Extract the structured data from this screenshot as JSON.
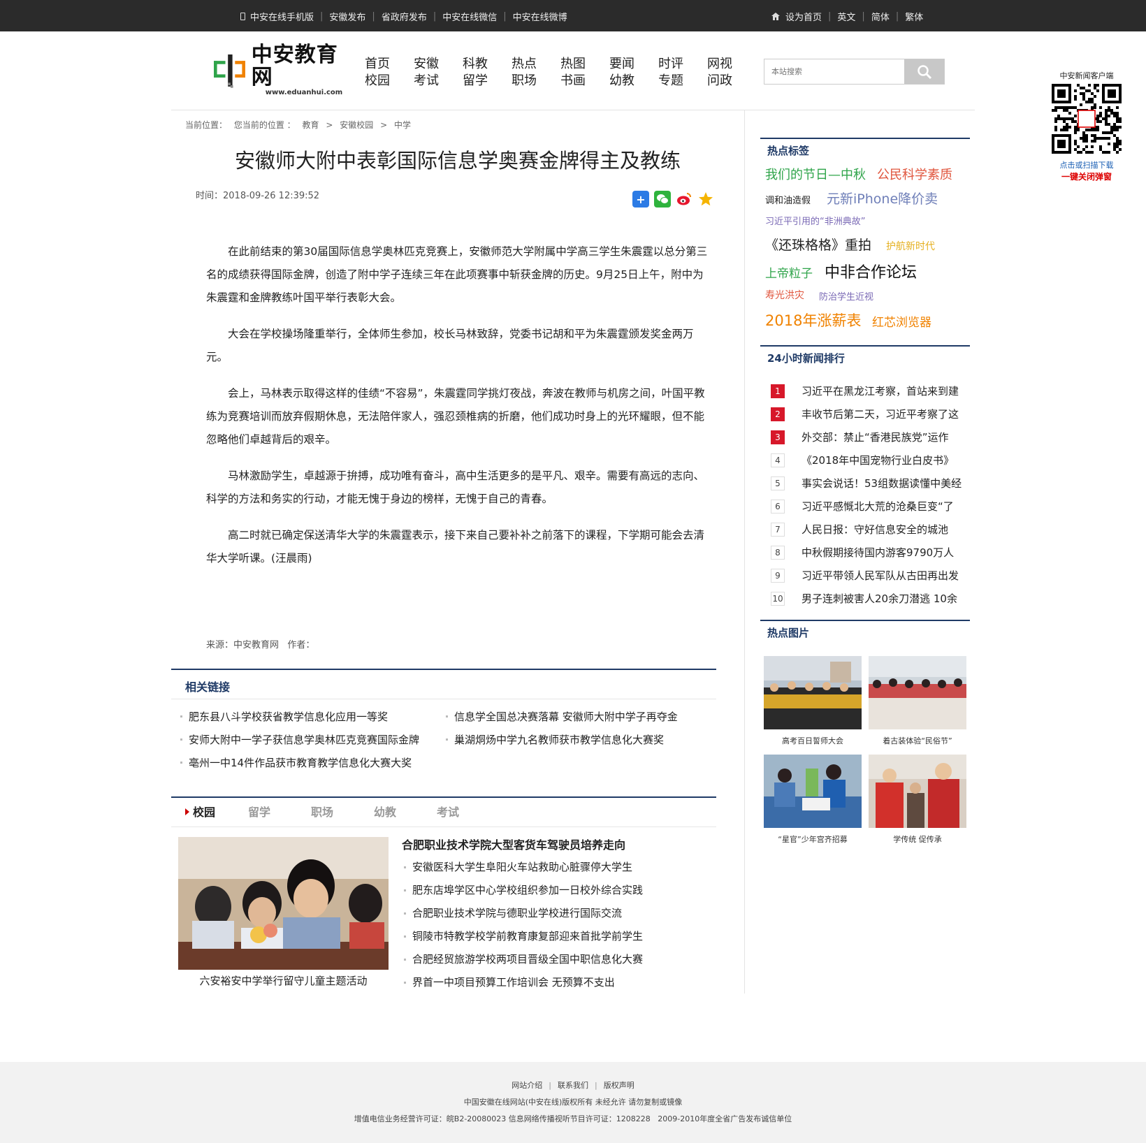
{
  "topbar": {
    "left_links": [
      "中安在线手机版",
      "安徽发布",
      "省政府发布",
      "中安在线微信",
      "中安在线微博"
    ],
    "right_links": [
      "设为首页",
      "英文",
      "简体",
      "繁体"
    ]
  },
  "logo": {
    "cn": "中安教育网",
    "en": "www.eduanhui.com"
  },
  "nav": [
    [
      "首页",
      "校园"
    ],
    [
      "安徽",
      "考试"
    ],
    [
      "科教",
      "留学"
    ],
    [
      "热点",
      "职场"
    ],
    [
      "热图",
      "书画"
    ],
    [
      "要闻",
      "幼教"
    ],
    [
      "时评",
      "专题"
    ],
    [
      "网视",
      "问政"
    ]
  ],
  "search": {
    "placeholder": "本站搜索"
  },
  "qr": {
    "title": "中安新闻客户端",
    "hint": "点击或扫描下载",
    "close": "一键关闭弹窗"
  },
  "breadcrumb": [
    "当前位置：",
    "您当前的位置 ：",
    "教育",
    ">",
    "安徽校园",
    ">",
    "中学"
  ],
  "article": {
    "title": "安徽师大附中表彰国际信息学奥赛金牌得主及教练",
    "time": "时间：2018-09-26 12:39:52",
    "paragraphs": [
      "在此前结束的第30届国际信息学奥林匹克竞赛上，安徽师范大学附属中学高三学生朱震霆以总分第三名的成绩获得国际金牌，创造了附中学子连续三年在此项赛事中斩获金牌的历史。9月25日上午，附中为朱震霆和金牌教练叶国平举行表彰大会。",
      "大会在学校操场隆重举行，全体师生参加，校长马林致辞，党委书记胡和平为朱震霆颁发奖金两万元。",
      "会上，马林表示取得这样的佳绩“不容易”，朱震霆同学挑灯夜战，奔波在教师与机房之间，叶国平教练为竞赛培训而放弃假期休息，无法陪伴家人，强忍颈椎病的折磨，他们成功时身上的光环耀眼，但不能忽略他们卓越背后的艰辛。",
      "马林激励学生，卓越源于拚搏，成功唯有奋斗，高中生活更多的是平凡、艰辛。需要有高远的志向、科学的方法和务实的行动，才能无愧于身边的榜样，无愧于自己的青春。",
      "高二时就已确定保送清华大学的朱震霆表示，接下来自己要补补之前落下的课程，下学期可能会去清华大学听课。(汪晨雨)"
    ],
    "source": "来源：中安教育网   作者："
  },
  "related": {
    "heading": "相关链接",
    "items": [
      "肥东县八斗学校获省教学信息化应用一等奖",
      "信息学全国总决赛落幕 安徽师大附中学子再夺金",
      "安师大附中一学子获信息学奥林匹克竞赛国际金牌",
      "巢湖烔炀中学九名教师获市教学信息化大赛奖",
      "亳州一中14件作品获市教育教学信息化大赛大奖"
    ]
  },
  "tabs": [
    "校园",
    "留学",
    "职场",
    "幼教",
    "考试"
  ],
  "featured": {
    "caption": "六安裕安中学举行留守儿童主题活动",
    "title": "合肥职业技术学院大型客货车驾驶员培养走向",
    "items": [
      "安徽医科大学生阜阳火车站救助心脏骤停大学生",
      "肥东店埠学区中心学校组织参加一日校外综合实践",
      "合肥职业技术学院与德职业学校进行国际交流",
      "铜陵市特教学校学前教育康复部迎来首批学前学生",
      "合肥经贸旅游学校两项目晋级全国中职信息化大赛",
      "界首一中项目预算工作培训会 无预算不支出"
    ]
  },
  "sidebar": {
    "tags_heading": "热点标签",
    "tags": [
      "我们的节日—中秋",
      "公民科学素质",
      "调和油造假",
      "元新iPhone降价卖",
      "习近平引用的“非洲典故”",
      "《还珠格格》重拍",
      "护航新时代",
      "上帝粒子",
      "中非合作论坛",
      "寿光洪灾",
      "防治学生近视",
      "2018年涨薪表",
      "红芯浏览器"
    ],
    "rank_heading": "24小时新闻排行",
    "rank": [
      "习近平在黑龙江考察，首站来到建",
      "丰收节后第二天，习近平考察了这",
      "外交部：禁止“香港民族党”运作",
      "《2018年中国宠物行业白皮书》",
      "事实会说话！53组数据读懂中美经",
      "习近平感慨北大荒的沧桑巨变“了",
      "人民日报：守好信息安全的城池",
      "中秋假期接待国内游客9790万人",
      "习近平带领人民军队从古田再出发",
      "男子连刺被害人20余刀潜逃 10余"
    ],
    "rank_numbers": [
      "1",
      "2",
      "3",
      "4",
      "5",
      "6",
      "7",
      "8",
      "9",
      "10"
    ],
    "pics_heading": "热点图片",
    "pics": [
      "高考百日誓师大会",
      "着古装体验“民俗节”",
      "“星官”少年宫齐招募",
      "学传统 促传承"
    ]
  },
  "footer": {
    "links": [
      "网站介绍",
      "联系我们",
      "版权声明"
    ],
    "copyright": "中国安徽在线网站(中安在线)版权所有 未经允许 请勿复制或镜像",
    "license": "增值电信业务经营许可证：皖B2-20080023 信息网络传播视听节目许可证：1208228   2009-2010年度全省广告发布诚信单位"
  },
  "colors": {
    "nav_dark": "#1f3a66",
    "rank_red": "#d7182a",
    "tag_green": "#2fa44a",
    "tag_orange": "#f08200"
  }
}
